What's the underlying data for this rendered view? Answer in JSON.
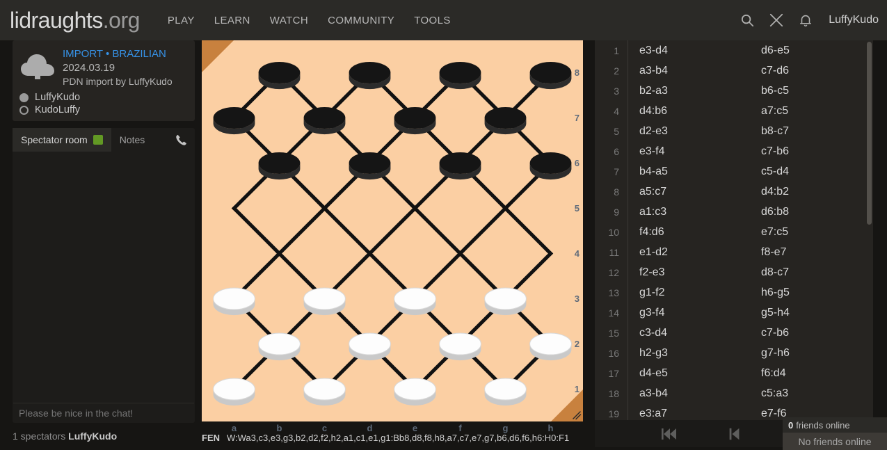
{
  "header": {
    "logo_main": "lidraughts",
    "logo_suffix": ".org",
    "nav": [
      {
        "label": "PLAY",
        "name": "play"
      },
      {
        "label": "LEARN",
        "name": "learn"
      },
      {
        "label": "WATCH",
        "name": "watch"
      },
      {
        "label": "COMMUNITY",
        "name": "community"
      },
      {
        "label": "TOOLS",
        "name": "tools"
      }
    ],
    "icons": [
      "search-icon",
      "challenge-swords-icon",
      "notifications-bell-icon"
    ],
    "username": "LuffyKudo"
  },
  "game_meta": {
    "icon": "cloud-upload-icon",
    "type": "IMPORT • BRAZILIAN",
    "date": "2024.03.19",
    "source": "PDN import by LuffyKudo",
    "players": [
      {
        "name": "LuffyKudo",
        "color": "black"
      },
      {
        "name": "KudoLuffy",
        "color": "white"
      }
    ]
  },
  "chat": {
    "tabs": [
      {
        "label": "Spectator room",
        "active": true
      },
      {
        "label": "Notes",
        "active": false
      }
    ],
    "call_icon": "phone-icon",
    "input_placeholder": "Please be nice in the chat!",
    "input_value": "",
    "spectators_count": "1 spectators",
    "spectators_names": "LuffyKudo"
  },
  "board": {
    "files": [
      "a",
      "b",
      "c",
      "d",
      "e",
      "f",
      "g",
      "h"
    ],
    "ranks": [
      "8",
      "7",
      "6",
      "5",
      "4",
      "3",
      "2",
      "1"
    ],
    "light_square_color": "#fbcfa3",
    "border_color": "#c8813e",
    "line_color": "#111111",
    "black_piece_color": "#151515",
    "white_piece_color": "#fdfdfd",
    "pieces": [
      {
        "square": "b8",
        "color": "black"
      },
      {
        "square": "d8",
        "color": "black"
      },
      {
        "square": "f8",
        "color": "black"
      },
      {
        "square": "h8",
        "color": "black"
      },
      {
        "square": "a7",
        "color": "black"
      },
      {
        "square": "c7",
        "color": "black"
      },
      {
        "square": "e7",
        "color": "black"
      },
      {
        "square": "g7",
        "color": "black"
      },
      {
        "square": "b6",
        "color": "black"
      },
      {
        "square": "d6",
        "color": "black"
      },
      {
        "square": "f6",
        "color": "black"
      },
      {
        "square": "h6",
        "color": "black"
      },
      {
        "square": "a3",
        "color": "white"
      },
      {
        "square": "c3",
        "color": "white"
      },
      {
        "square": "e3",
        "color": "white"
      },
      {
        "square": "g3",
        "color": "white"
      },
      {
        "square": "b2",
        "color": "white"
      },
      {
        "square": "d2",
        "color": "white"
      },
      {
        "square": "f2",
        "color": "white"
      },
      {
        "square": "h2",
        "color": "white"
      },
      {
        "square": "a1",
        "color": "white"
      },
      {
        "square": "c1",
        "color": "white"
      },
      {
        "square": "e1",
        "color": "white"
      },
      {
        "square": "g1",
        "color": "white"
      }
    ],
    "resize_handle": "resize-handle-icon"
  },
  "fen": {
    "label": "FEN",
    "value": "W:Wa3,c3,e3,g3,b2,d2,f2,h2,a1,c1,e1,g1:Bb8,d8,f8,h8,a7,c7,e7,g7,b6,d6,f6,h6:H0:F1"
  },
  "moves": [
    {
      "n": "1",
      "white": "e3-d4",
      "black": "d6-e5"
    },
    {
      "n": "2",
      "white": "a3-b4",
      "black": "c7-d6"
    },
    {
      "n": "3",
      "white": "b2-a3",
      "black": "b6-c5"
    },
    {
      "n": "4",
      "white": "d4:b6",
      "black": "a7:c5"
    },
    {
      "n": "5",
      "white": "d2-e3",
      "black": "b8-c7"
    },
    {
      "n": "6",
      "white": "e3-f4",
      "black": "c7-b6"
    },
    {
      "n": "7",
      "white": "b4-a5",
      "black": "c5-d4"
    },
    {
      "n": "8",
      "white": "a5:c7",
      "black": "d4:b2"
    },
    {
      "n": "9",
      "white": "a1:c3",
      "black": "d6:b8"
    },
    {
      "n": "10",
      "white": "f4:d6",
      "black": "e7:c5"
    },
    {
      "n": "11",
      "white": "e1-d2",
      "black": "f8-e7"
    },
    {
      "n": "12",
      "white": "f2-e3",
      "black": "d8-c7"
    },
    {
      "n": "13",
      "white": "g1-f2",
      "black": "h6-g5"
    },
    {
      "n": "14",
      "white": "g3-f4",
      "black": "g5-h4"
    },
    {
      "n": "15",
      "white": "c3-d4",
      "black": "c7-b6"
    },
    {
      "n": "16",
      "white": "h2-g3",
      "black": "g7-h6"
    },
    {
      "n": "17",
      "white": "d4-e5",
      "black": "f6:d4"
    },
    {
      "n": "18",
      "white": "a3-b4",
      "black": "c5:a3"
    },
    {
      "n": "19",
      "white": "e3:a7",
      "black": "e7-f6"
    }
  ],
  "move_controls": [
    {
      "name": "first-move-button",
      "icon": "skip-to-start-icon"
    },
    {
      "name": "previous-move-button",
      "icon": "step-backward-icon"
    },
    {
      "name": "next-move-button",
      "icon": "step-forward-icon"
    }
  ],
  "friends": {
    "count": "0",
    "header_label": "friends online",
    "body_text": "No friends online"
  }
}
